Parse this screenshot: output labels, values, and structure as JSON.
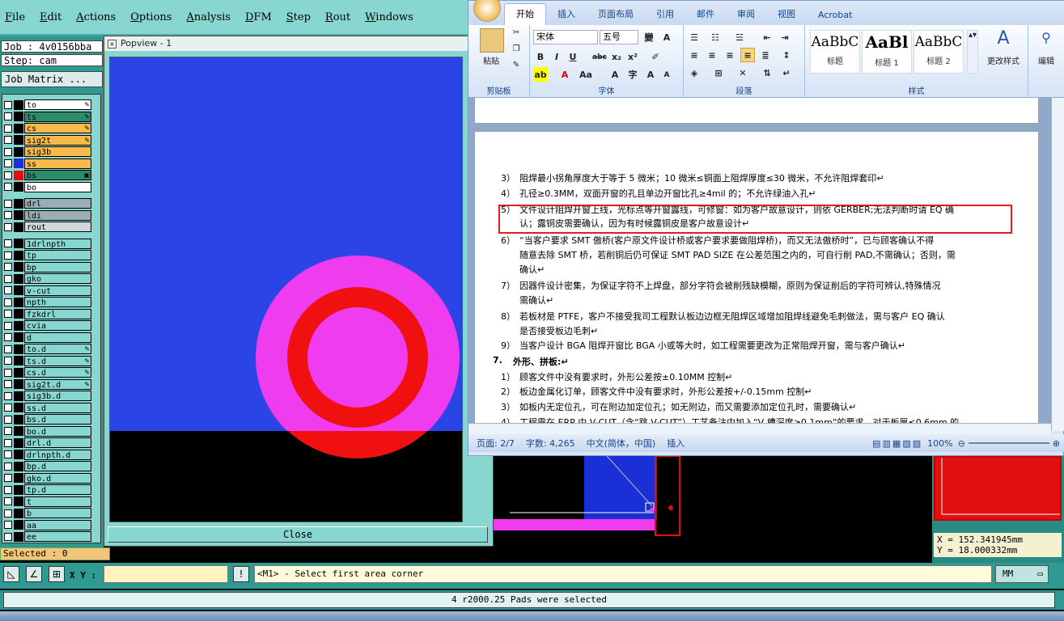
{
  "menubar": {
    "items": [
      "File",
      "Edit",
      "Actions",
      "Options",
      "Analysis",
      "DFM",
      "Step",
      "Rout",
      "Windows"
    ]
  },
  "leftpanel": {
    "job": "Job : 4v0156bba",
    "step": "Step: cam",
    "job_matrix": "Job Matrix ...",
    "layers": [
      {
        "name": "to",
        "color": "#ffffff",
        "swatch": "#000000",
        "mark": "✎"
      },
      {
        "name": "ts",
        "color": "#2e8b6a",
        "swatch": "#000000",
        "mark": "✎"
      },
      {
        "name": "cs",
        "color": "#f6b94a",
        "swatch": "#000000",
        "mark": "✎"
      },
      {
        "name": "sig2t",
        "color": "#f6b94a",
        "swatch": "#000000",
        "mark": "✎"
      },
      {
        "name": "sig3b",
        "color": "#f6b94a",
        "swatch": "#000000",
        "mark": ""
      },
      {
        "name": "ss",
        "color": "#f6b94a",
        "swatch": "#1b2fd6",
        "mark": ""
      },
      {
        "name": "bs",
        "color": "#2e8b6a",
        "swatch": "#e01010",
        "mark": "▣"
      },
      {
        "name": "bo",
        "color": "#ffffff",
        "swatch": "#000000",
        "mark": ""
      },
      {
        "name": "drl",
        "color": "#9aaeb4",
        "swatch": "#000000",
        "mark": ""
      },
      {
        "name": "ldi",
        "color": "#9aaeb4",
        "swatch": "#000000",
        "mark": ""
      },
      {
        "name": "rout",
        "color": "#cfd8da",
        "swatch": "#000000",
        "mark": ""
      },
      {
        "name": "1drlnpth",
        "color": "#88d6d0",
        "swatch": "#000000",
        "mark": ""
      },
      {
        "name": "tp",
        "color": "#88d6d0",
        "swatch": "#000000",
        "mark": ""
      },
      {
        "name": "bp",
        "color": "#88d6d0",
        "swatch": "#000000",
        "mark": ""
      },
      {
        "name": "gko",
        "color": "#88d6d0",
        "swatch": "#000000",
        "mark": ""
      },
      {
        "name": "v-cut",
        "color": "#88d6d0",
        "swatch": "#000000",
        "mark": ""
      },
      {
        "name": "npth",
        "color": "#88d6d0",
        "swatch": "#000000",
        "mark": ""
      },
      {
        "name": "fzkdrl",
        "color": "#88d6d0",
        "swatch": "#000000",
        "mark": ""
      },
      {
        "name": "cvia",
        "color": "#88d6d0",
        "swatch": "#000000",
        "mark": ""
      },
      {
        "name": "d",
        "color": "#88d6d0",
        "swatch": "#000000",
        "mark": ""
      },
      {
        "name": "to.d",
        "color": "#88d6d0",
        "swatch": "#000000",
        "mark": "✎"
      },
      {
        "name": "ts.d",
        "color": "#88d6d0",
        "swatch": "#000000",
        "mark": "✎"
      },
      {
        "name": "cs.d",
        "color": "#88d6d0",
        "swatch": "#000000",
        "mark": "✎"
      },
      {
        "name": "sig2t.d",
        "color": "#88d6d0",
        "swatch": "#000000",
        "mark": "✎"
      },
      {
        "name": "sig3b.d",
        "color": "#88d6d0",
        "swatch": "#000000",
        "mark": ""
      },
      {
        "name": "ss.d",
        "color": "#88d6d0",
        "swatch": "#000000",
        "mark": ""
      },
      {
        "name": "bs.d",
        "color": "#88d6d0",
        "swatch": "#000000",
        "mark": ""
      },
      {
        "name": "bo.d",
        "color": "#88d6d0",
        "swatch": "#000000",
        "mark": ""
      },
      {
        "name": "drl.d",
        "color": "#88d6d0",
        "swatch": "#000000",
        "mark": ""
      },
      {
        "name": "drlnpth.d",
        "color": "#88d6d0",
        "swatch": "#000000",
        "mark": ""
      },
      {
        "name": "bp.d",
        "color": "#88d6d0",
        "swatch": "#000000",
        "mark": ""
      },
      {
        "name": "gko.d",
        "color": "#88d6d0",
        "swatch": "#000000",
        "mark": ""
      },
      {
        "name": "tp.d",
        "color": "#88d6d0",
        "swatch": "#000000",
        "mark": ""
      },
      {
        "name": "t",
        "color": "#88d6d0",
        "swatch": "#000000",
        "mark": ""
      },
      {
        "name": "b",
        "color": "#88d6d0",
        "swatch": "#000000",
        "mark": ""
      },
      {
        "name": "aa",
        "color": "#88d6d0",
        "swatch": "#000000",
        "mark": ""
      },
      {
        "name": "ee",
        "color": "#88d6d0",
        "swatch": "#000000",
        "mark": ""
      }
    ],
    "selected": "Selected : 0"
  },
  "popview": {
    "title": "Popview - 1",
    "close_label": "Close",
    "colors": {
      "background": "#2b44e6",
      "pad_outer": "#ee3cee",
      "ring": "#f01010"
    }
  },
  "word": {
    "tabs": [
      "开始",
      "插入",
      "页面布局",
      "引用",
      "邮件",
      "审阅",
      "视图",
      "Acrobat"
    ],
    "clipboard": {
      "paste": "粘贴",
      "label": "剪贴板"
    },
    "font": {
      "name": "宋体",
      "size": "五号",
      "label": "字体"
    },
    "paragraph": {
      "label": "段落"
    },
    "styles": {
      "label": "样式",
      "items": [
        {
          "sample": "AaBbC",
          "name": "标题"
        },
        {
          "sample": "AaBl",
          "name": "标题 1"
        },
        {
          "sample": "AaBbC",
          "name": "标题 2"
        }
      ],
      "change": "更改样式"
    },
    "edit": {
      "label": "编辑"
    },
    "doc_lines": [
      {
        "num": "3）",
        "text": "阻焊最小拐角厚度大于等于 5 微米；10 微米≤铜面上阻焊厚度≤30 微米，不允许阻焊套印↵"
      },
      {
        "num": "4）",
        "text": "孔径≥0.3MM，双面开窗的孔且单边开窗比孔≥4mil 的；不允许绿油入孔↵"
      },
      {
        "num": "5）",
        "text": "文件设计阻焊开窗上线，光标点等开窗露线，可修窗：如为客户故意设计，则依 GERBER;无法判断时请 EQ 确"
      },
      {
        "num": "",
        "text": "认；露铜皮需要确认，因为有时候露铜皮是客户故意设计↵"
      },
      {
        "num": "6）",
        "text": "“当客户要求 SMT 傲桥(客户原文件设计桥或客户要求要做阻焊桥)，而又无法傲桥时”，已与顾客确认不得"
      },
      {
        "num": "",
        "text": "随意去除 SMT 桥，若削铜后仍可保证 SMT PAD SIZE 在公差范围之内的，可自行削 PAD,不需确认；否则，需"
      },
      {
        "num": "",
        "text": "确认↵"
      },
      {
        "num": "7）",
        "text": "因器件设计密集，为保证字符不上焊盘，部分字符会被削残缺模糊，原则为保证削后的字符可辨认,特殊情况"
      },
      {
        "num": "",
        "text": "需确认↵"
      },
      {
        "num": "8）",
        "text": "若板材是 PTFE，客户不接受我司工程默认板边边框无阻焊区域增加阻焊线避免毛刺做法，需与客户 EQ 确认"
      },
      {
        "num": "",
        "text": "是否接受板边毛刺↵"
      },
      {
        "num": "9）",
        "text": "当客户设计 BGA 阻焊开窗比 BGA 小或等大时，如工程需要更改为正常阻焊开窗，需与客户确认↵"
      },
      {
        "num": "7.",
        "text": "外形、拼板:↵"
      },
      {
        "num": "1）",
        "text": "顾客文件中没有要求时，外形公差按±0.10MM 控制↵"
      },
      {
        "num": "2）",
        "text": "板边金属化订单，顾客文件中没有要求时，外形公差按+/-0.15mm 控制↵"
      },
      {
        "num": "3）",
        "text": "如板内无定位孔，可在附边加定位孔；如无附边，而又需要添加定位孔时，需要确认↵"
      },
      {
        "num": "4）",
        "text": "工程需在 ERP 中 V-CUT（含“跳 V-CUT”）工艺备注中加入“V 槽深度≥0.1mm”的要求，对于板厚≤0.6mm 的"
      }
    ],
    "status": {
      "page": "页面: 2/7",
      "words": "字数: 4,265",
      "lang": "中文(简体，中国)",
      "mode": "插入",
      "zoom": "100%"
    }
  },
  "coords": {
    "x": "X = 152.341945mm",
    "y": "Y = 18.000332mm"
  },
  "bottombar": {
    "xy_label": "X Y :",
    "xy_value": "",
    "prompt": "<M1> - Select first area corner",
    "units": "MM"
  },
  "message": "4 r2000.25 Pads were selected"
}
